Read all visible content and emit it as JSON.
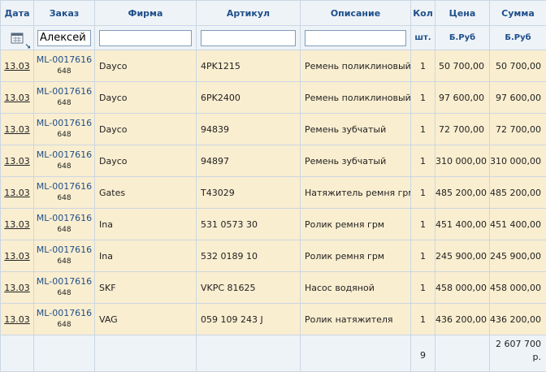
{
  "headers": {
    "date": "Дата",
    "order": "Заказ",
    "firm": "Фирма",
    "article": "Артикул",
    "description": "Описание",
    "qty": "Кол",
    "price": "Цена",
    "sum": "Сумма"
  },
  "units": {
    "qty": "шт.",
    "price": "Б.Руб",
    "sum": "Б.Руб"
  },
  "filters": {
    "order_value": "Алексей",
    "firm_value": "",
    "article_value": "",
    "description_value": ""
  },
  "rows": [
    {
      "date": "13.03",
      "order": "ML-0017616",
      "order_sub": "648",
      "firm": "Dayco",
      "article": "4PK1215",
      "description": "Ремень поликлиновый",
      "qty": "1",
      "price": "50 700,00",
      "sum": "50 700,00"
    },
    {
      "date": "13.03",
      "order": "ML-0017616",
      "order_sub": "648",
      "firm": "Dayco",
      "article": "6PK2400",
      "description": "Ремень поликлиновый",
      "qty": "1",
      "price": "97 600,00",
      "sum": "97 600,00"
    },
    {
      "date": "13.03",
      "order": "ML-0017616",
      "order_sub": "648",
      "firm": "Dayco",
      "article": "94839",
      "description": "Ремень зубчатый",
      "qty": "1",
      "price": "72 700,00",
      "sum": "72 700,00"
    },
    {
      "date": "13.03",
      "order": "ML-0017616",
      "order_sub": "648",
      "firm": "Dayco",
      "article": "94897",
      "description": "Ремень зубчатый",
      "qty": "1",
      "price": "310 000,00",
      "sum": "310 000,00"
    },
    {
      "date": "13.03",
      "order": "ML-0017616",
      "order_sub": "648",
      "firm": "Gates",
      "article": "T43029",
      "description": "Натяжитель ремня грм",
      "qty": "1",
      "price": "485 200,00",
      "sum": "485 200,00"
    },
    {
      "date": "13.03",
      "order": "ML-0017616",
      "order_sub": "648",
      "firm": "Ina",
      "article": "531 0573 30",
      "description": "Ролик ремня грм",
      "qty": "1",
      "price": "451 400,00",
      "sum": "451 400,00"
    },
    {
      "date": "13.03",
      "order": "ML-0017616",
      "order_sub": "648",
      "firm": "Ina",
      "article": "532 0189 10",
      "description": "Ролик ремня грм",
      "qty": "1",
      "price": "245 900,00",
      "sum": "245 900,00"
    },
    {
      "date": "13.03",
      "order": "ML-0017616",
      "order_sub": "648",
      "firm": "SKF",
      "article": "VKPC 81625",
      "description": "Насос водяной",
      "qty": "1",
      "price": "458 000,00",
      "sum": "458 000,00"
    },
    {
      "date": "13.03",
      "order": "ML-0017616",
      "order_sub": "648",
      "firm": "VAG",
      "article": "059 109 243 J",
      "description": "Ролик натяжителя",
      "qty": "1",
      "price": "436 200,00",
      "sum": "436 200,00"
    }
  ],
  "footer": {
    "qty_total": "9",
    "sum_total_line1": "2 607 700",
    "sum_total_line2": "р."
  },
  "icons": {
    "calendar": "calendar-icon",
    "sort": "sort-arrow-icon"
  },
  "colors": {
    "row_bg": "#faeed0",
    "header_bg": "#eef3f8",
    "header_text": "#1f4f8a",
    "border": "#cbd6e2"
  }
}
